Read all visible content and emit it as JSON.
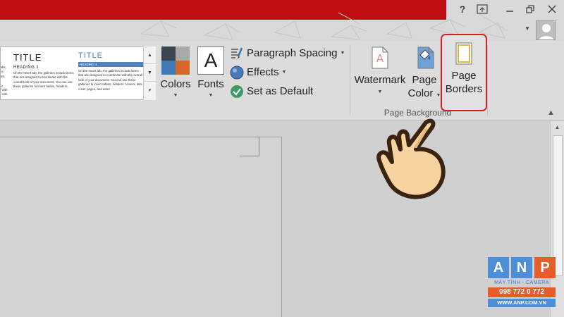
{
  "window": {
    "help": "?",
    "accent_color": "#c00d12"
  },
  "style_gallery": {
    "thumbs": [
      {
        "body": "ribbon to tabs, the galleries include items that are designed to coordinate with the overall look of your document."
      },
      {
        "title": "TITLE",
        "heading": "HEADING 1",
        "body": "On the Insert tab, the galleries include items that are designed to coordinate with the overall look of your document. You can use these galleries to insert tables, headers,"
      },
      {
        "title": "TITLE",
        "heading": "HEADING 1",
        "body": "On the Insert tab, the galleries include items that are designed to coordinate with the overall look of your document. You can use these galleries to insert tables, headers, footers, lists, cover pages, and other"
      }
    ]
  },
  "ribbon": {
    "colors_label": "Colors",
    "fonts_label": "Fonts",
    "fonts_glyph": "A",
    "paragraph_spacing_label": "Paragraph Spacing",
    "effects_label": "Effects",
    "set_default_label": "Set as Default",
    "watermark_label": "Watermark",
    "page_color_label_1": "Page",
    "page_color_label_2": "Color",
    "page_borders_label_1": "Page",
    "page_borders_label_2": "Borders",
    "group_label": "Page Background",
    "highlight_color": "#d71f26"
  },
  "theme_colors": [
    "#3c4653",
    "#a9a9a9",
    "#3f7bb9",
    "#d7662a"
  ],
  "icons": {
    "help": "help-icon",
    "ribbon_display": "ribbon-display-icon",
    "minimize": "minimize-icon",
    "restore": "restore-icon",
    "close": "close-icon",
    "pointer": "hand-pointer-icon"
  },
  "logo": {
    "letters": [
      "A",
      "N",
      "P"
    ],
    "tagline": "MÁY TÍNH - CAMERA",
    "phone": "098 772 0 772",
    "web": "WWW.ANP.COM.VN"
  }
}
